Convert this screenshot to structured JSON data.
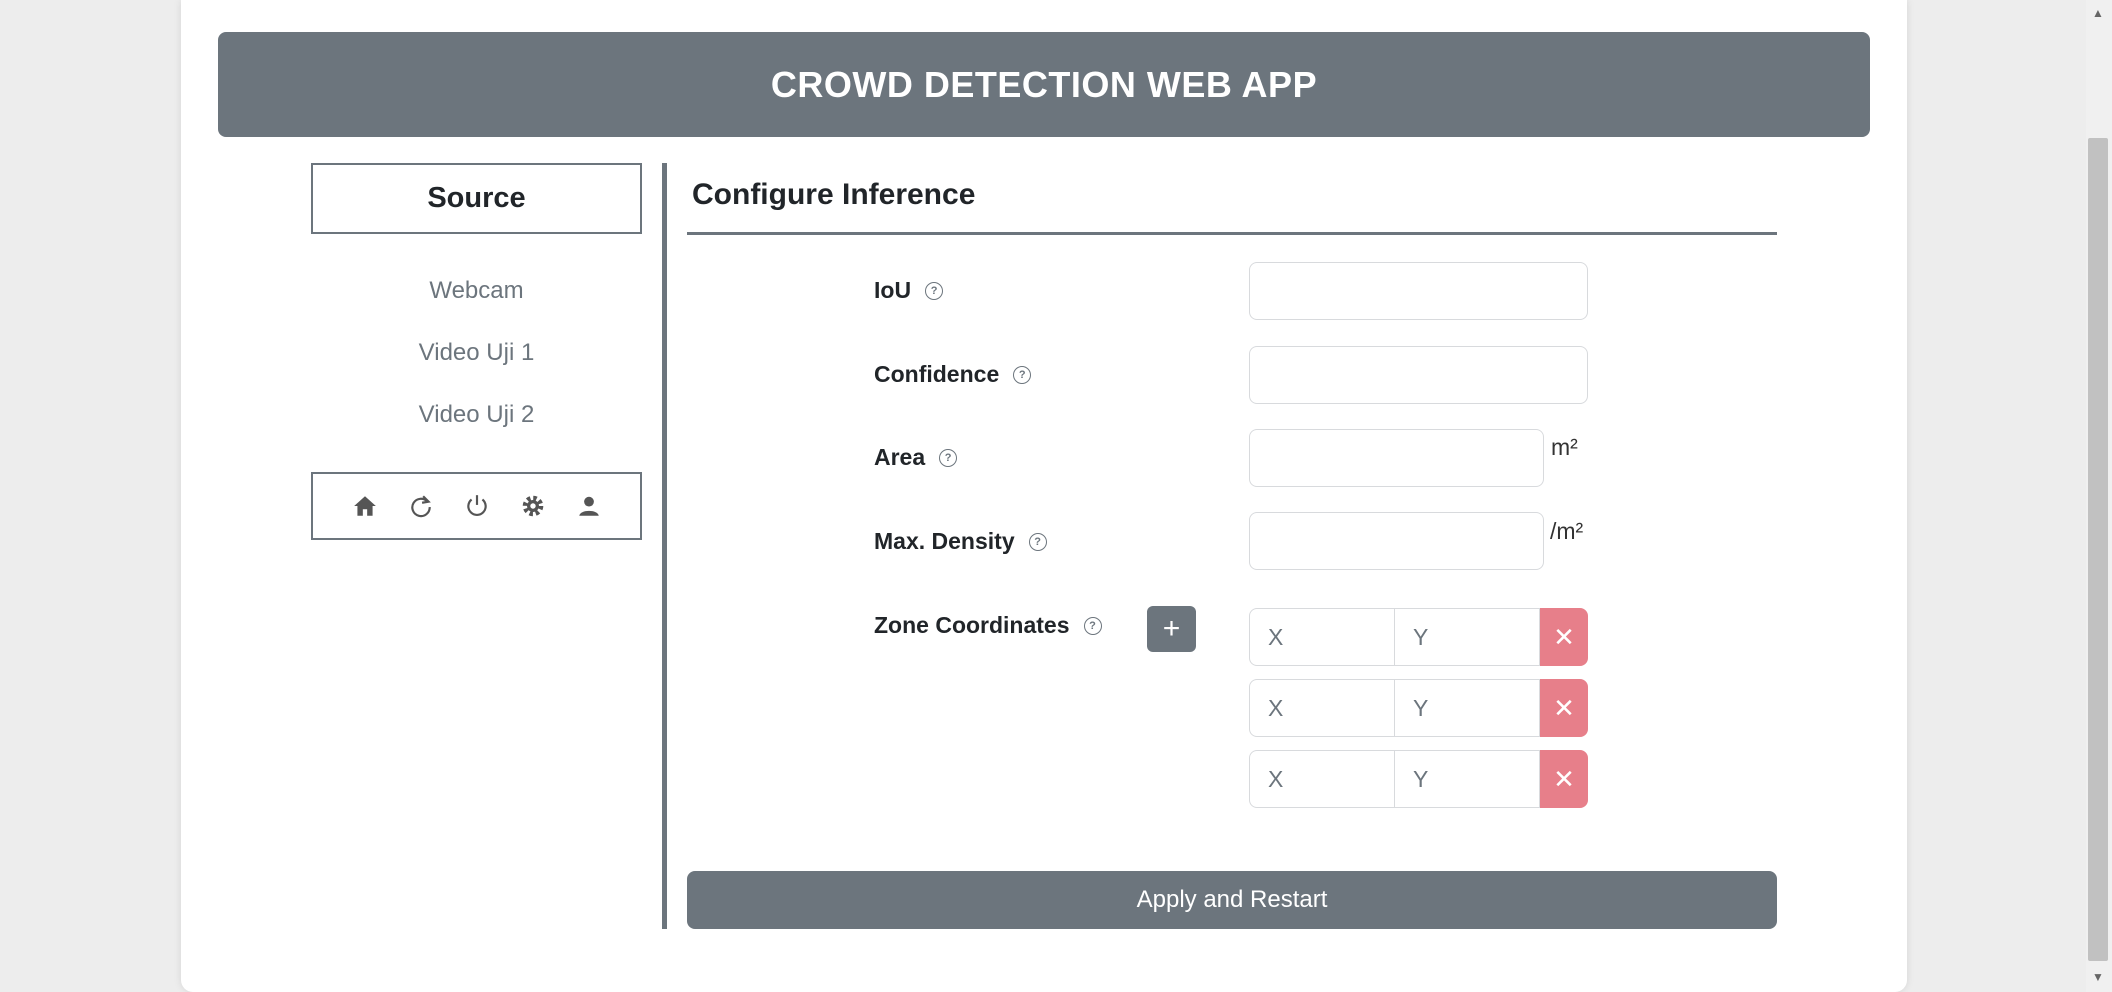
{
  "app": {
    "title": "CROWD DETECTION WEB APP"
  },
  "sidebar": {
    "heading": "Source",
    "items": [
      {
        "label": "Webcam"
      },
      {
        "label": "Video Uji 1"
      },
      {
        "label": "Video Uji 2"
      }
    ],
    "icons": [
      "home-icon",
      "refresh-icon",
      "power-icon",
      "gear-icon",
      "user-icon"
    ]
  },
  "config": {
    "title": "Configure Inference",
    "help_glyph": "?",
    "fields": {
      "iou": {
        "label": "IoU",
        "value": ""
      },
      "confidence": {
        "label": "Confidence",
        "value": ""
      },
      "area": {
        "label": "Area",
        "value": "",
        "unit": "m²"
      },
      "max_density": {
        "label": "Max. Density",
        "value": "",
        "unit": "/m²"
      }
    },
    "zone": {
      "label": "Zone Coordinates",
      "add_glyph": "+",
      "remove_glyph": "✕",
      "rows": [
        {
          "x_placeholder": "X",
          "y_placeholder": "Y"
        },
        {
          "x_placeholder": "X",
          "y_placeholder": "Y"
        },
        {
          "x_placeholder": "X",
          "y_placeholder": "Y"
        }
      ]
    },
    "apply_label": "Apply and Restart"
  },
  "colors": {
    "primary": "#6c757d",
    "danger": "#e77f8a",
    "background": "#ededed"
  }
}
